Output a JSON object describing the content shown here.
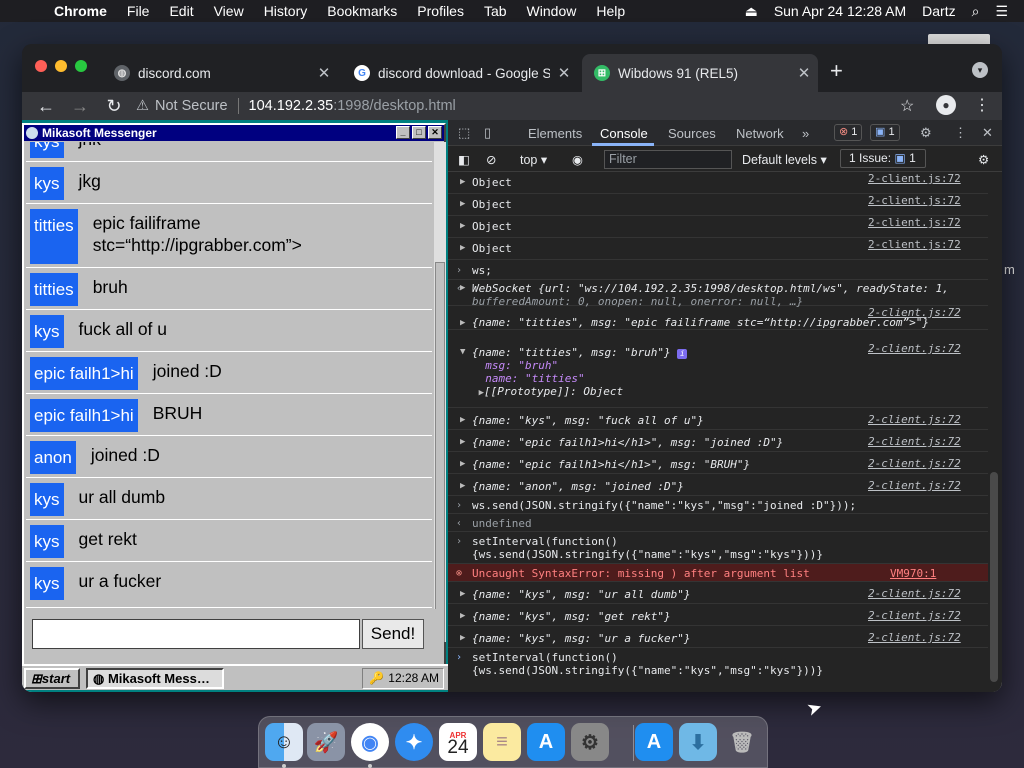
{
  "menubar": {
    "apple": "",
    "app_name": "Chrome",
    "items": [
      "File",
      "Edit",
      "View",
      "History",
      "Bookmarks",
      "Profiles",
      "Tab",
      "Window",
      "Help"
    ],
    "datetime": "Sun Apr 24  12:28 AM",
    "user": "Dartz"
  },
  "tabs": [
    {
      "title": "discord.com",
      "favicon": "globe-icon"
    },
    {
      "title": "discord download - Google Se",
      "favicon": "google-icon"
    },
    {
      "title": "Wibdows 91 (REL5)",
      "favicon": "windows-flag-icon"
    }
  ],
  "toolbar": {
    "security": "Not Secure",
    "url_host": "104.192.2.35",
    "url_path": ":1998/desktop.html"
  },
  "messenger": {
    "title": "Mikasoft Messenger",
    "messages": [
      {
        "name": "kys",
        "msg": "jnk"
      },
      {
        "name": "kys",
        "msg": "jkg"
      },
      {
        "name": "titties",
        "msg": "epic failiframe\nstc=“http://ipgrabber.com”>"
      },
      {
        "name": "titties",
        "msg": "bruh"
      },
      {
        "name": "kys",
        "msg": "fuck all of u"
      },
      {
        "name": "epic failh1>hi",
        "msg": "joined :D"
      },
      {
        "name": "epic failh1>hi",
        "msg": "BRUH"
      },
      {
        "name": "anon",
        "msg": "joined :D"
      },
      {
        "name": "kys",
        "msg": "ur all dumb"
      },
      {
        "name": "kys",
        "msg": "get rekt"
      },
      {
        "name": "kys",
        "msg": "ur a fucker"
      }
    ],
    "input_value": "",
    "send_label": "Send!"
  },
  "taskbar": {
    "start_label": "start",
    "task_label": "Mikasoft Mess…",
    "clock": "12:28 AM"
  },
  "devtools": {
    "tabs": [
      "Elements",
      "Console",
      "Sources",
      "Network"
    ],
    "more": "»",
    "error_count": "1",
    "message_count": "1",
    "context": "top",
    "filter_placeholder": "Filter",
    "levels": "Default levels",
    "issues": "1 Issue:",
    "issues_count": "1",
    "src_client": "2-client.js:72",
    "src_vm": "VM970:1",
    "lines": {
      "obj": "Object",
      "ws_cmd": "ws;",
      "ws_obj1": "WebSocket {url: \"ws://104.192.2.35:1998/desktop.html/ws\", readyState: 1,",
      "ws_obj2": "bufferedAmount: 0, onopen: null, onerror: null, …}",
      "t1": "{name: \"titties\", msg: \"epic failiframe stc=“http://ipgrabber.com”>\"}",
      "t2": "{name: \"titties\", msg: \"bruh\"}",
      "t2_msg": "msg: \"bruh\"",
      "t2_name": "name: \"titties\"",
      "t2_proto": "[[Prototype]]: Object",
      "k1": "{name: \"kys\", msg: \"fuck all of u\"}",
      "e1": "{name: \"epic failh1>hi</h1>\", msg: \"joined :D\"}",
      "e2": "{name: \"epic failh1>hi</h1>\", msg: \"BRUH\"}",
      "a1": "{name: \"anon\", msg: \"joined :D\"}",
      "send_cmd": "ws.send(JSON.stringify({\"name\":\"kys\",\"msg\":\"joined :D\"}));",
      "undef": "undefined",
      "si1a": "setInterval(function()",
      "si1b": "{ws.send(JSON.stringify({\"name\":\"kys\",\"msg\":\"kys\"}))}",
      "err": "Uncaught SyntaxError: missing ) after argument list",
      "k2": "{name: \"kys\", msg: \"ur all dumb\"}",
      "k3": "{name: \"kys\", msg: \"get rekt\"}",
      "k4": "{name: \"kys\", msg: \"ur a fucker\"}",
      "si2a": "setInterval(function()",
      "si2b": "{ws.send(JSON.stringify({\"name\":\"kys\",\"msg\":\"kys\"}))}"
    }
  },
  "dock": {
    "items": [
      "finder-icon",
      "launchpad-icon",
      "chrome-icon",
      "safari-icon",
      "calendar-icon",
      "notes-icon",
      "app-store-icon",
      "system-preferences-icon",
      "app-store-2-icon",
      "downloads-folder-icon",
      "trash-icon"
    ],
    "calendar_month": "APR",
    "calendar_day": "24"
  },
  "colors": {
    "accent": "#1a64f0",
    "win_title": "#000080",
    "error_bg": "#4e1c1c"
  }
}
